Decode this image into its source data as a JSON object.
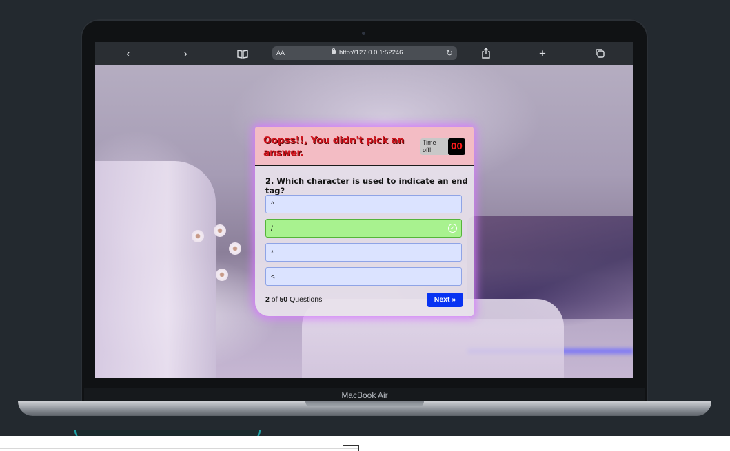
{
  "browser": {
    "url": "http://127.0.0.1:52246",
    "text_size_label": "AA",
    "icons": [
      "back-icon",
      "forward-icon",
      "reader-icon",
      "lock-icon",
      "reload-icon",
      "share-icon",
      "new-tab-icon",
      "tabs-icon"
    ]
  },
  "device": {
    "label": "MacBook Air"
  },
  "quiz": {
    "result_title": "Oopss!!, You didn't pick an answer.",
    "timer_label": "Time off!",
    "timer_value": "00",
    "question": "2. Which character is used to indicate an end tag?",
    "options": [
      {
        "text": "^",
        "state": "neutral"
      },
      {
        "text": "/",
        "state": "correct"
      },
      {
        "text": "*",
        "state": "neutral"
      },
      {
        "text": "<",
        "state": "neutral"
      }
    ],
    "progress": {
      "current": "2",
      "of": "of",
      "total": "50",
      "suffix": "Questions"
    },
    "next_label": "Next",
    "next_icon": "double-chevron-right-icon"
  },
  "colors": {
    "header_bg": "#f3bcc4",
    "title_red": "#d0141d",
    "correct_green": "#a8f28f",
    "option_blue": "#dbe3ff",
    "next_button": "#0833f2",
    "card_glow": "#d678ff"
  }
}
